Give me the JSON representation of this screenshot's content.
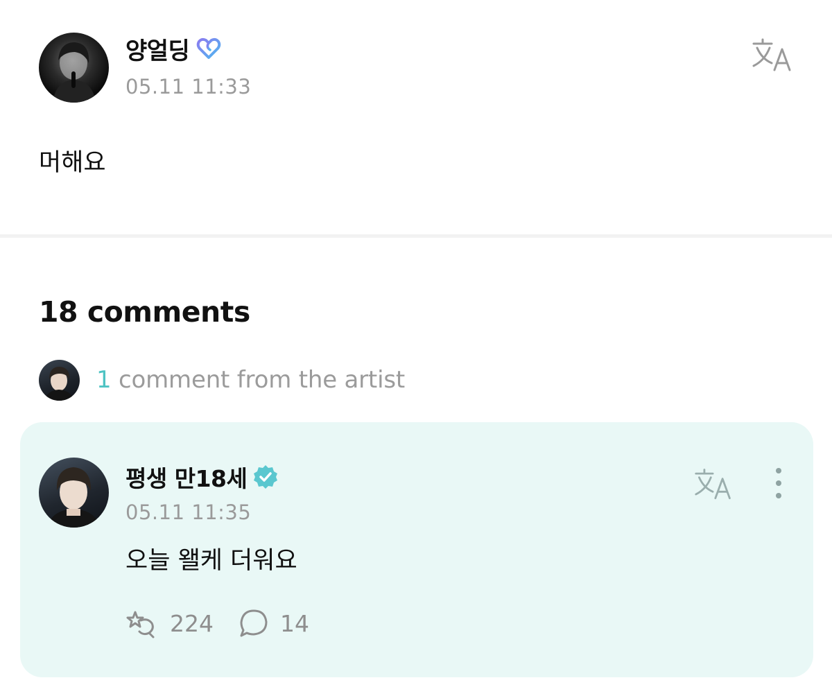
{
  "post": {
    "author": "양얼딩",
    "membership_icon": "membership-heart-icon",
    "timestamp": "05.11 11:33",
    "body": "머해요",
    "translate_icon": "translate-icon"
  },
  "comments": {
    "count_label": "18 comments",
    "artist_summary": {
      "count": "1",
      "text": "comment from the artist"
    },
    "artist_comment": {
      "author": "평생 만18세",
      "verified_icon": "verified-badge-icon",
      "timestamp": "05.11 11:35",
      "body": "오늘 왤케 더워요",
      "likes": "224",
      "replies": "14"
    }
  },
  "colors": {
    "accent_teal": "#4ec3c3",
    "card_background": "#e9f8f6",
    "secondary_text": "#9a9a9a"
  }
}
